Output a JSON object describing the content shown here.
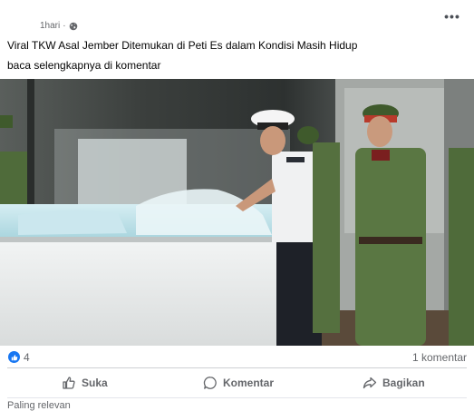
{
  "post": {
    "time": "1hari",
    "time_separator": "·",
    "privacy_icon": "globe-icon",
    "more_icon": "more-options-icon",
    "caption_line1": "Viral TKW Asal Jember Ditemukan di Peti Es dalam Kondisi Masih Hidup",
    "caption_line2": "baca selengkapnya di komentar"
  },
  "stats": {
    "reaction_icon": "like-icon",
    "reaction_count": "4",
    "comment_count": "1 komentar"
  },
  "actions": {
    "like_label": "Suka",
    "comment_label": "Komentar",
    "share_label": "Bagikan"
  },
  "footer": {
    "sort_label": "Paling relevan"
  },
  "colors": {
    "facebook_blue": "#1877f2",
    "secondary_text": "#65676b",
    "divider": "#ced0d4"
  }
}
